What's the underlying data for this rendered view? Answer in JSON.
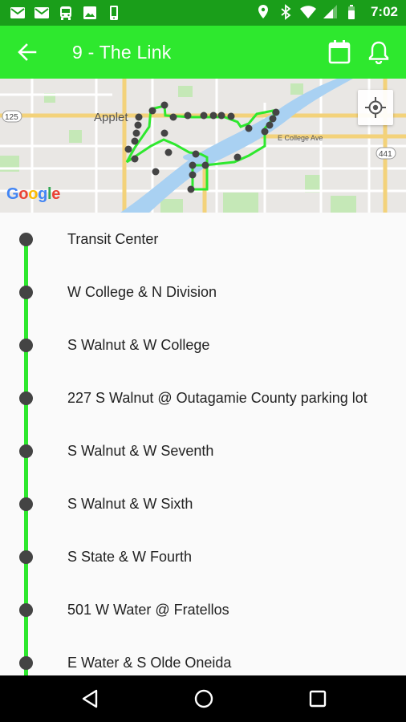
{
  "status_bar": {
    "time": "7:02",
    "left_icons": [
      "mail-icon",
      "mail-icon",
      "bus-icon",
      "image-icon",
      "phone-icon"
    ],
    "right_icons": [
      "location-icon",
      "bluetooth-icon",
      "wifi-icon",
      "signal-icon",
      "battery-icon"
    ]
  },
  "toolbar": {
    "title": "9 - The Link",
    "back_icon": "arrow-left-icon",
    "calendar_icon": "calendar-icon",
    "bell_icon": "bell-icon"
  },
  "map": {
    "city_label": "Applet",
    "street_label": "E College Ave",
    "shield_125": "125",
    "shield_441": "441",
    "google_logo": "Google",
    "route_color": "#2ee82e"
  },
  "stops": [
    {
      "name": "Transit Center"
    },
    {
      "name": "W College & N Division"
    },
    {
      "name": "S Walnut & W College"
    },
    {
      "name": "227 S Walnut @ Outagamie County parking lot"
    },
    {
      "name": "S Walnut & W Seventh"
    },
    {
      "name": "S Walnut & W Sixth"
    },
    {
      "name": "S State & W Fourth"
    },
    {
      "name": "501 W Water @ Fratellos"
    },
    {
      "name": "E Water & S Olde Oneida"
    }
  ],
  "colors": {
    "status_bar": "#1a9e1a",
    "toolbar": "#2ee82e",
    "route_line": "#2ee82e",
    "stop_dot": "#444444",
    "nav_bar": "#000000"
  }
}
